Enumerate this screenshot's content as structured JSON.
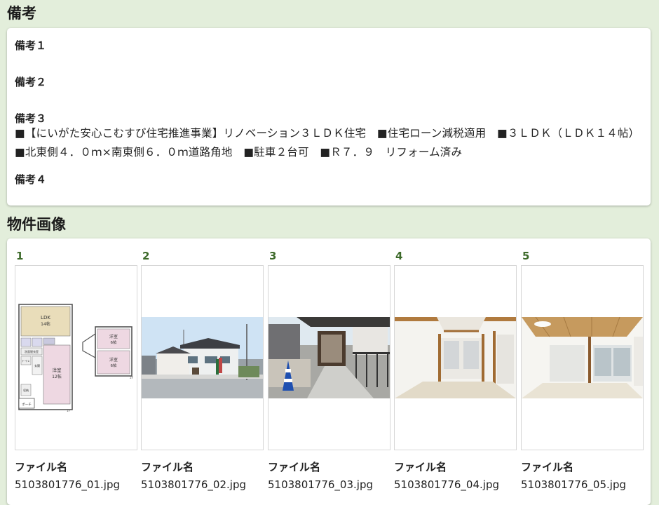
{
  "remarks": {
    "title": "備考",
    "items": [
      {
        "label": "備考１",
        "text": ""
      },
      {
        "label": "備考２",
        "text": ""
      },
      {
        "label": "備考３",
        "text": "■【にいがた安心こむすび住宅推進事業】リノベーション３ＬＤＫ住宅　■住宅ローン減税適用　■３ＬＤＫ（ＬＤＫ１４帖）■北東側４．０ｍ×南東側６．０ｍ道路角地　■駐車２台可　■Ｒ７．９　リフォーム済み"
      },
      {
        "label": "備考４",
        "text": ""
      }
    ]
  },
  "images": {
    "title": "物件画像",
    "file_label": "ファイル名",
    "floorplan_labels": {
      "ldk": "LDK",
      "ldk_size": "14帖",
      "room_a": "洋室",
      "room_a_size": "12帖",
      "room_b": "洋室",
      "room_b_size": "6帖",
      "room_c": "洋室",
      "room_c_size": "6帖",
      "porch": "ポーチ",
      "wash": "洗面脱衣室",
      "toilet": "トイレ",
      "entrance": "玄関",
      "storage": "収納",
      "floor1": "1F",
      "floor2": "2F"
    },
    "items": [
      {
        "index": "1",
        "filename": "5103801776_01.jpg",
        "kind": "floorplan-image"
      },
      {
        "index": "2",
        "filename": "5103801776_02.jpg",
        "kind": "exterior-photo"
      },
      {
        "index": "3",
        "filename": "5103801776_03.jpg",
        "kind": "entrance-photo"
      },
      {
        "index": "4",
        "filename": "5103801776_04.jpg",
        "kind": "room-photo"
      },
      {
        "index": "5",
        "filename": "5103801776_05.jpg",
        "kind": "living-room-photo"
      }
    ]
  }
}
